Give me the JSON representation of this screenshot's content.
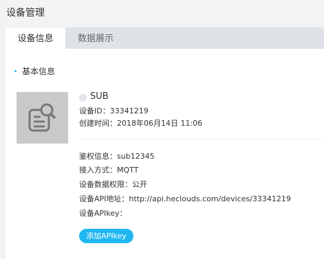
{
  "page": {
    "title": "设备管理"
  },
  "tabs": [
    {
      "label": "设备信息"
    },
    {
      "label": "数据展示"
    }
  ],
  "section": {
    "title": "基本信息"
  },
  "device": {
    "name": "SUB",
    "id_line": "设备ID：33341219",
    "created_line": "创建时间：2018年06月14日 11:06"
  },
  "details": {
    "auth": "鉴权信息：sub12345",
    "access": "接入方式：MQTT",
    "permission": "设备数据权限：公开",
    "api_url": "设备API地址：http://api.heclouds.com/devices/33341219",
    "api_key": "设备APIkey："
  },
  "actions": {
    "add_apikey": "添加APIkey"
  },
  "colors": {
    "accent": "#1fb7f0",
    "tab_bar": "#dfe3e7",
    "background": "#f1f3f5"
  },
  "icons": {
    "device_placeholder": "document-search-icon"
  }
}
